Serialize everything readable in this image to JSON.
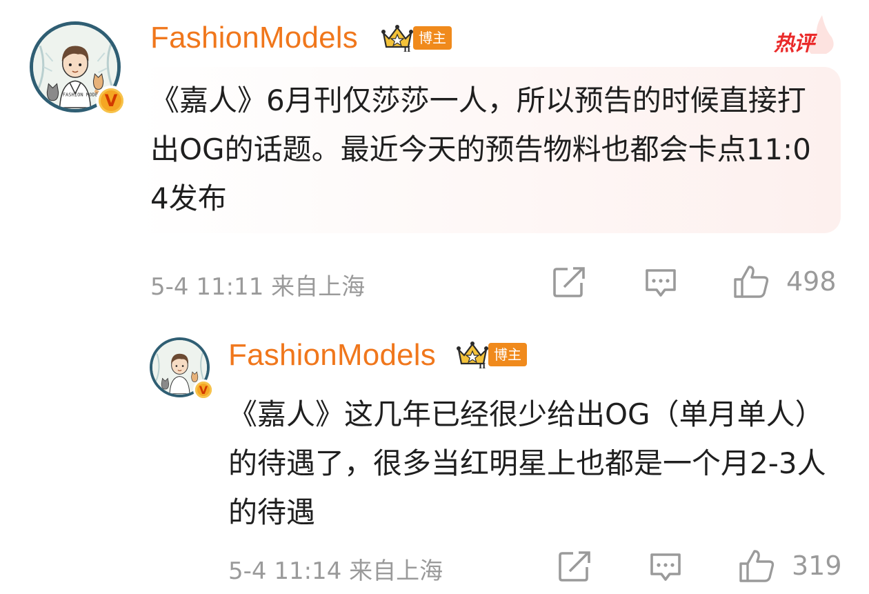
{
  "badge_colors": {
    "username": "#f0771c",
    "role_badge": "#f08a1c",
    "hot": "#ea2a2a",
    "meta": "#9a9a9a"
  },
  "hot_tag": {
    "label": "热评",
    "icon": "flame-icon"
  },
  "main_comment": {
    "avatar_icon": "avatar-boy-with-cats",
    "avatar_caption": "FASHION MODELS",
    "verified_icon": "verified-v-icon",
    "verified_letter": "V",
    "username": "FashionModels",
    "rank_icon": "crown-rank-icon",
    "rank_level": "II",
    "role_badge": "博主",
    "text": "《嘉人》6月刊仅莎莎一人，所以预告的时候直接打出OG的话题。最近今天的预告物料也都会卡点11:04发布",
    "meta": "5-4 11:11 来自上海",
    "share_icon": "share-icon",
    "comment_icon": "comment-icon",
    "like_icon": "thumbs-up-icon",
    "likes": "498"
  },
  "reply_comment": {
    "avatar_icon": "avatar-boy-with-cats",
    "verified_icon": "verified-v-icon",
    "verified_letter": "V",
    "username": "FashionModels",
    "rank_icon": "crown-rank-icon",
    "rank_level": "II",
    "role_badge": "博主",
    "text": "《嘉人》这几年已经很少给出OG（单月单人）的待遇了，很多当红明星上也都是一个月2-3人的待遇",
    "meta": "5-4 11:14 来自上海",
    "share_icon": "share-icon",
    "comment_icon": "comment-icon",
    "like_icon": "thumbs-up-icon",
    "likes": "319"
  }
}
